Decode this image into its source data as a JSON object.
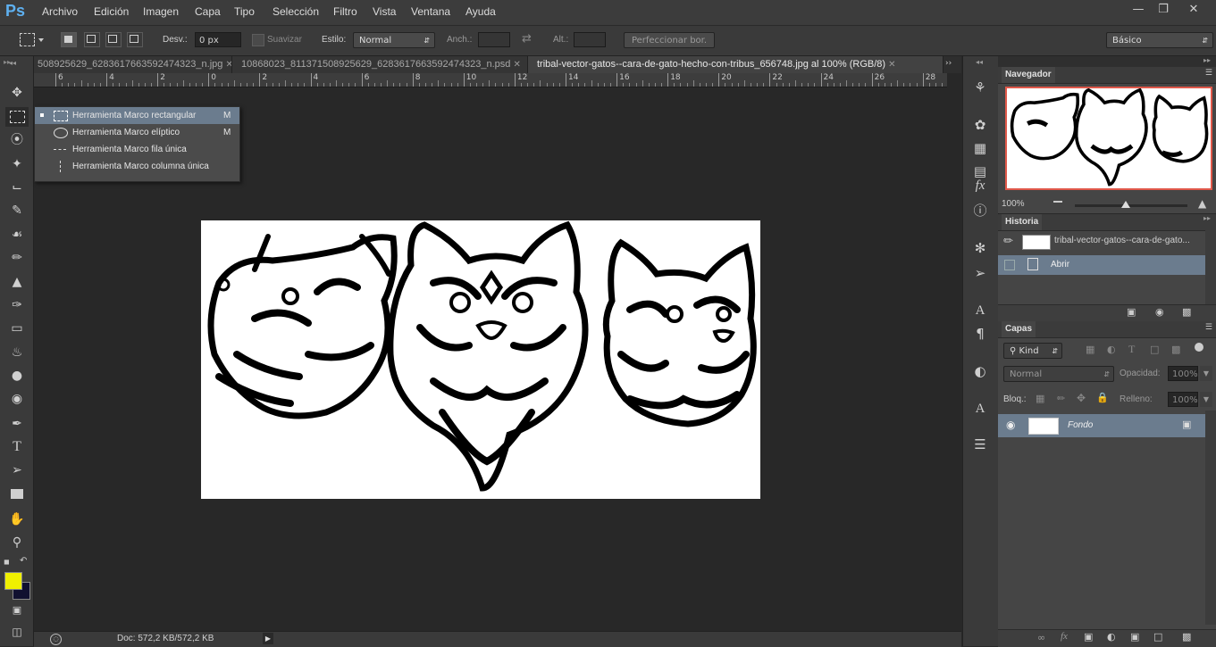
{
  "app": {
    "logo": "Ps"
  },
  "menu": [
    "Archivo",
    "Edición",
    "Imagen",
    "Capa",
    "Tipo",
    "Selección",
    "Filtro",
    "Vista",
    "Ventana",
    "Ayuda"
  ],
  "options": {
    "desv_label": "Desv.:",
    "desv_value": "0 px",
    "suavizar_label": "Suavizar",
    "estilo_label": "Estilo:",
    "estilo_value": "Normal",
    "anch_label": "Anch.:",
    "alt_label": "Alt.:",
    "perfeccionar_label": "Perfeccionar bor.",
    "workspace_value": "Básico"
  },
  "tabs": [
    {
      "label": "508925629_6283617663592474323_n.jpg",
      "active": false
    },
    {
      "label": "10868023_811371508925629_6283617663592474323_n.psd",
      "active": false
    },
    {
      "label": "tribal-vector-gatos--cara-de-gato-hecho-con-tribus_656748.jpg al 100% (RGB/8)",
      "active": true
    }
  ],
  "ruler": [
    "6",
    "4",
    "2",
    "0",
    "2",
    "4",
    "6",
    "8",
    "10",
    "12",
    "14",
    "16",
    "18",
    "20",
    "22",
    "24",
    "26",
    "28"
  ],
  "flyout": {
    "items": [
      {
        "label": "Herramienta Marco rectangular",
        "shortcut": "M",
        "selected": true
      },
      {
        "label": "Herramienta Marco elíptico",
        "shortcut": "M",
        "selected": false
      },
      {
        "label": "Herramienta Marco fila única",
        "shortcut": "",
        "selected": false
      },
      {
        "label": "Herramienta Marco columna única",
        "shortcut": "",
        "selected": false
      }
    ]
  },
  "colors": {
    "foreground": "#f0f000",
    "background": "#101030",
    "accent_selection": "#6b7c8e",
    "navigator_frame": "#e0584a"
  },
  "status": {
    "doc": "Doc: 572,2 KB/572,2 KB"
  },
  "navigator": {
    "title": "Navegador",
    "zoom": "100%"
  },
  "history": {
    "title": "Historia",
    "snapshot_label": "tribal-vector-gatos--cara-de-gato...",
    "items": [
      {
        "label": "Abrir"
      }
    ]
  },
  "layers": {
    "title": "Capas",
    "filter_label": "Kind",
    "blend_mode": "Normal",
    "opacity_label": "Opacidad:",
    "opacity_value": "100%",
    "lock_label": "Bloq.:",
    "fill_label": "Relleno:",
    "fill_value": "100%",
    "items": [
      {
        "name": "Fondo"
      }
    ]
  }
}
